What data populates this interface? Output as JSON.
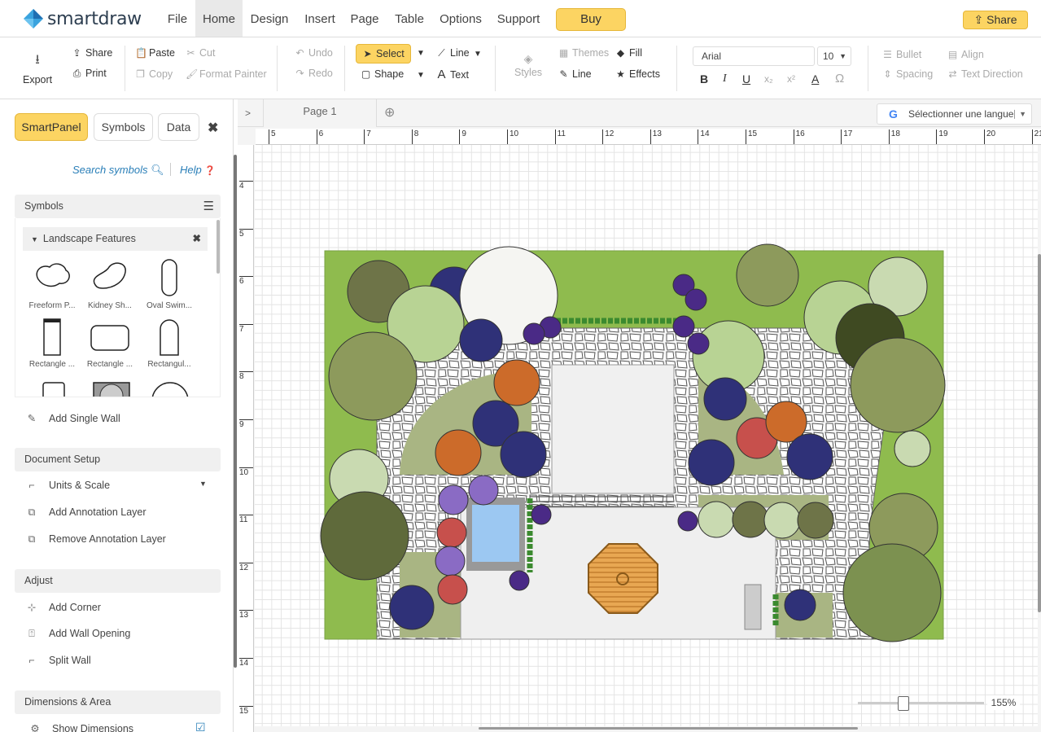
{
  "app": {
    "logo_text": "smartdraw"
  },
  "menu": {
    "items": [
      "File",
      "Home",
      "Design",
      "Insert",
      "Page",
      "Table",
      "Options",
      "Support"
    ],
    "active": "Home",
    "buy_label": "Buy",
    "share_label": "Share"
  },
  "ribbon": {
    "export": "Export",
    "share": "Share",
    "print": "Print",
    "paste": "Paste",
    "cut": "Cut",
    "copy": "Copy",
    "format_painter": "Format Painter",
    "undo": "Undo",
    "redo": "Redo",
    "select": "Select",
    "shape": "Shape",
    "line": "Line",
    "text": "Text",
    "styles": "Styles",
    "themes": "Themes",
    "fill": "Fill",
    "line2": "Line",
    "effects": "Effects",
    "font": "Arial",
    "font_size": "10",
    "bullet": "Bullet",
    "align": "Align",
    "spacing": "Spacing",
    "text_direction": "Text Direction"
  },
  "panel": {
    "tabs": [
      "SmartPanel",
      "Symbols",
      "Data"
    ],
    "search": "Search symbols",
    "help": "Help",
    "symbols_header": "Symbols",
    "library": "Landscape Features",
    "symbols": [
      "Freeform P...",
      "Kidney Sh...",
      "Oval Swim...",
      "Rectangle ...",
      "Rectangle ...",
      "Rectangul..."
    ],
    "add_single_wall": "Add Single Wall",
    "document_setup": "Document Setup",
    "units_scale": "Units & Scale",
    "add_annotation": "Add Annotation Layer",
    "remove_annotation": "Remove Annotation Layer",
    "adjust": "Adjust",
    "add_corner": "Add Corner",
    "add_wall_opening": "Add Wall Opening",
    "split_wall": "Split Wall",
    "dimensions": "Dimensions & Area",
    "show_dimensions": "Show Dimensions"
  },
  "canvas": {
    "page_tab": "Page 1",
    "language": "Sélectionner une langue",
    "ruler_top": [
      "5",
      "6",
      "7",
      "8",
      "9",
      "10",
      "11",
      "12",
      "13",
      "14",
      "15",
      "16",
      "17",
      "18",
      "19",
      "20",
      "21"
    ],
    "ruler_left": [
      "4",
      "5",
      "6",
      "7",
      "8",
      "9",
      "10",
      "11",
      "12",
      "13",
      "14",
      "15"
    ],
    "zoom": "155%"
  },
  "colors": {
    "accent": "#fcd462",
    "lawn": "#8db84e",
    "patio": "#efefef"
  }
}
